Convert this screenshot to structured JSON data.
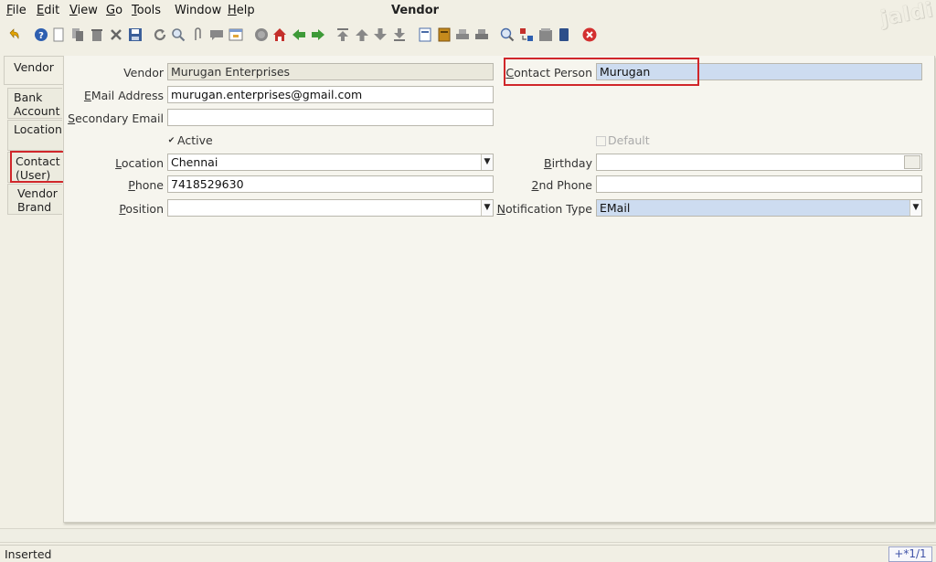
{
  "window": {
    "title": "Vendor",
    "logo_text": "jaldi"
  },
  "menu": [
    {
      "mnemonic": "F",
      "rest": "ile"
    },
    {
      "mnemonic": "E",
      "rest": "dit"
    },
    {
      "mnemonic": "V",
      "rest": "iew"
    },
    {
      "mnemonic": "G",
      "rest": "o"
    },
    {
      "mnemonic": "T",
      "rest": "ools"
    },
    {
      "mnemonic": "",
      "rest": "Window"
    },
    {
      "mnemonic": "H",
      "rest": "elp"
    }
  ],
  "toolbar": [
    "undo-icon",
    "help-icon",
    "new-record-icon",
    "copy-record-icon",
    "delete-record-icon",
    "delete-selection-icon",
    "save-icon",
    "refresh-icon",
    "find-icon",
    "attachment-icon",
    "chat-icon",
    "grid-toggle-icon",
    "history-icon",
    "home-icon",
    "back-icon",
    "forward-icon",
    "first-record-icon",
    "previous-record-icon",
    "next-record-icon",
    "last-record-icon",
    "report-icon",
    "archive-icon",
    "print-preview-icon",
    "print-icon",
    "zoom-across-icon",
    "request-icon",
    "product-info-icon",
    "workflow-icon",
    "exit-icon"
  ],
  "tabs": [
    {
      "lines": [
        "Vendor"
      ],
      "active": true
    },
    {
      "lines": [
        "Bank",
        "Account"
      ]
    },
    {
      "lines": [
        "Location"
      ]
    },
    {
      "lines": [
        "Contact",
        "(User)"
      ]
    },
    {
      "lines": [
        "Vendor",
        "Brand"
      ]
    }
  ],
  "form": {
    "vendor": {
      "label": "Vendor",
      "value": "Murugan Enterprises"
    },
    "email": {
      "label_m": "E",
      "label_rest": "Mail Address",
      "value": "murugan.enterprises@gmail.com"
    },
    "secondary_email": {
      "label_m": "S",
      "label_rest": "econdary Email",
      "value": ""
    },
    "active": {
      "label": "Active",
      "checked": true
    },
    "location": {
      "label_m": "L",
      "label_rest": "ocation",
      "value": "Chennai"
    },
    "phone": {
      "label_m": "P",
      "label_rest": "hone",
      "value": "7418529630"
    },
    "position": {
      "label_m": "P",
      "label_rest": "osition",
      "value": ""
    },
    "contact_person": {
      "label_m": "C",
      "label_rest": "ontact Person",
      "value": "Murugan"
    },
    "default": {
      "label": "Default",
      "checked": false
    },
    "birthday": {
      "label_m": "B",
      "label_rest": "irthday",
      "value": ""
    },
    "phone2": {
      "label_m": "2",
      "label_rest": "nd Phone",
      "value": ""
    },
    "notification_type": {
      "label_m": "N",
      "label_rest": "otification Type",
      "value": "EMail"
    }
  },
  "status": {
    "text": "Inserted",
    "record": "+*1/1"
  },
  "colors": {
    "highlight": "#d0262a",
    "mandatory": "#cddcf0",
    "readonly": "#eae8dc"
  }
}
